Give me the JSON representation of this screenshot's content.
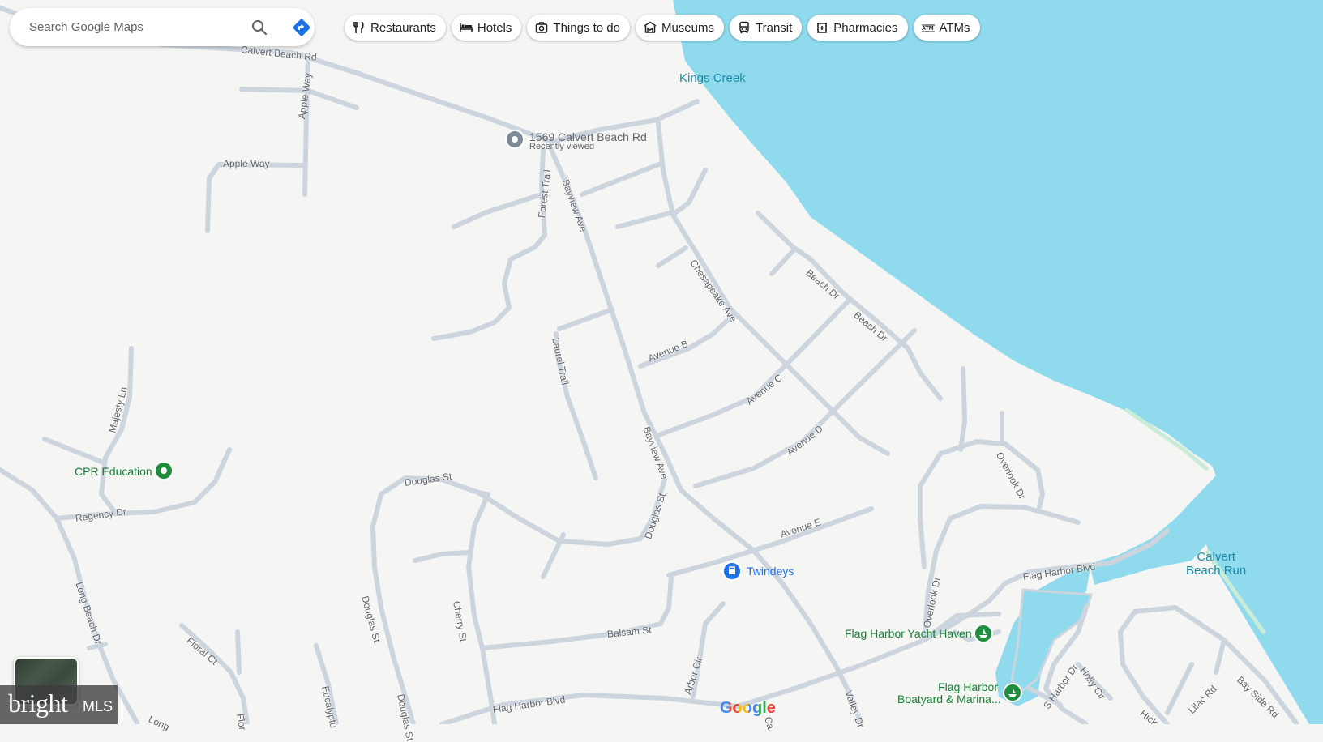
{
  "search": {
    "placeholder": "Search Google Maps",
    "search_icon": "search-icon",
    "directions_icon": "directions-icon"
  },
  "chips": [
    {
      "label": "Restaurants",
      "icon": "fork-knife-icon"
    },
    {
      "label": "Hotels",
      "icon": "bed-icon"
    },
    {
      "label": "Things to do",
      "icon": "camera-icon"
    },
    {
      "label": "Museums",
      "icon": "museum-icon"
    },
    {
      "label": "Transit",
      "icon": "train-icon"
    },
    {
      "label": "Pharmacies",
      "icon": "pharmacy-icon"
    },
    {
      "label": "ATMs",
      "icon": "atm-icon"
    }
  ],
  "pins": {
    "address_title": "1569 Calvert Beach Rd",
    "address_subtitle": "Recently viewed",
    "cpr": "CPR Education",
    "twindeys": "Twindeys",
    "yacht": "Flag Harbor Yacht Haven",
    "boatyard_line1": "Flag Harbor",
    "boatyard_line2": "Boatyard & Marina..."
  },
  "water": {
    "kings_creek": "Kings Creek",
    "calvert_run_line1": "Calvert",
    "calvert_run_line2": "Beach Run"
  },
  "streets": {
    "calvert_beach_rd": "Calvert Beach Rd",
    "apple_way": "Apple Way",
    "apple_way_v": "Apple Way",
    "forest_trail": "Forest Trail",
    "bayview_1": "Bayview Ave",
    "bayview_2": "Bayview Ave",
    "chesapeake": "Chesapeake Ave",
    "beach_dr_1": "Beach Dr",
    "beach_dr_2": "Beach Dr",
    "laurel": "Laurel Trail",
    "avenue_b": "Avenue B",
    "avenue_c": "Avenue C",
    "avenue_d": "Avenue D",
    "avenue_e": "Avenue E",
    "majesty": "Majesty Ln",
    "regency": "Regency Dr",
    "long_beach_1": "Long Beach Dr",
    "long_beach_2": "Long",
    "douglas_1": "Douglas St",
    "douglas_2": "Douglas St",
    "douglas_3": "Douglas St",
    "douglas_4": "Douglas St",
    "cherry": "Cherry St",
    "balsam": "Balsam St",
    "flag_harbor_1": "Flag Harbor Blvd",
    "flag_harbor_2": "Flag Harbor Blvd",
    "overlook_1": "Overlook Dr",
    "overlook_2": "Overlook Dr",
    "floral": "Floral Ct",
    "flor": "Flor",
    "eucalyptus": "Eucalyptu",
    "arbor": "Arbor Cir",
    "valley": "Valley Dr",
    "ca": "Ca",
    "s_harbor": "S Harbor Dr",
    "holly": "Holly Cir",
    "hick": "Hick",
    "lilac": "Lilac Rd",
    "bay_side": "Bay Side Rd"
  },
  "brand": {
    "google": "Google",
    "mls_bright": "bright",
    "mls_suffix": "MLS"
  },
  "colors": {
    "water": "#8fdaed",
    "road": "#ccd5de",
    "land": "#f5f5f4",
    "poi_green": "#1e8e3e",
    "poi_blue": "#1a73e8",
    "pin_gray": "#7b8a96"
  }
}
